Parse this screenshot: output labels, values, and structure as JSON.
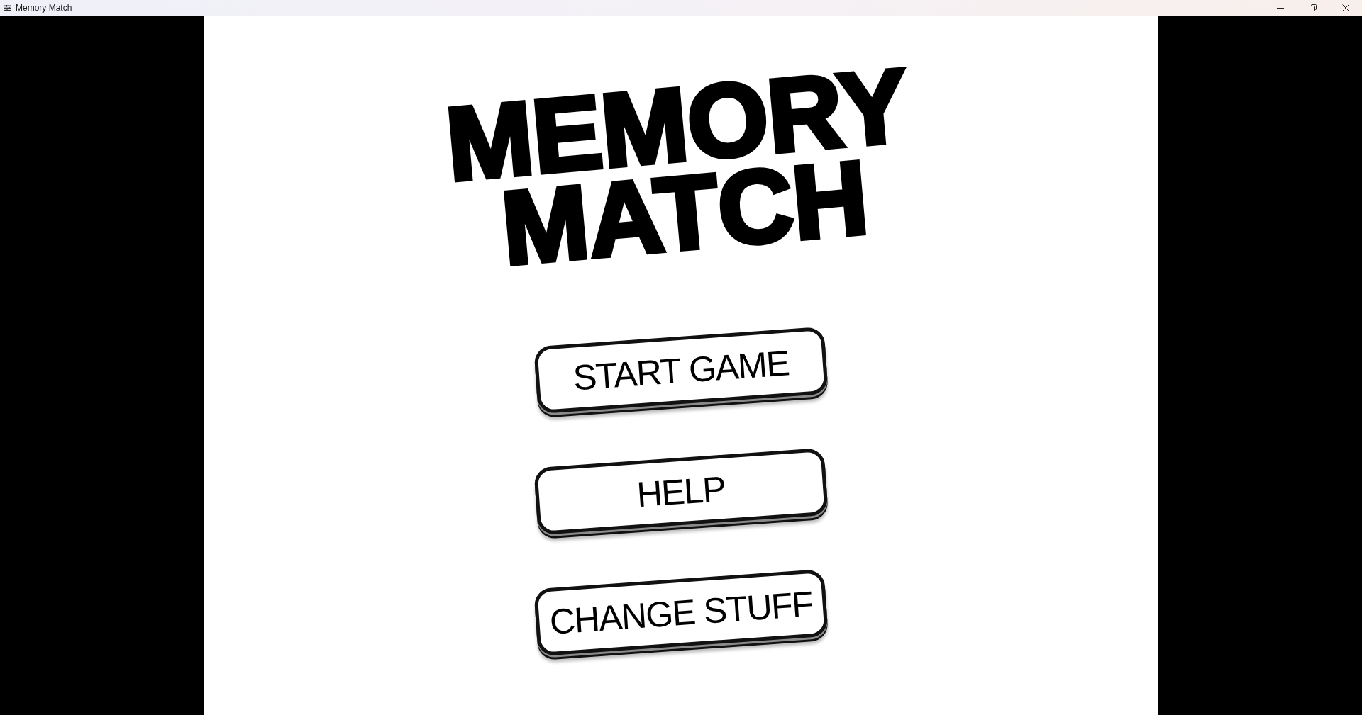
{
  "window": {
    "title": "Memory Match"
  },
  "game": {
    "title": "MEMORY MATCH",
    "menu": [
      {
        "label": "START GAME"
      },
      {
        "label": "HELP"
      },
      {
        "label": "CHANGE STUFF"
      }
    ]
  }
}
